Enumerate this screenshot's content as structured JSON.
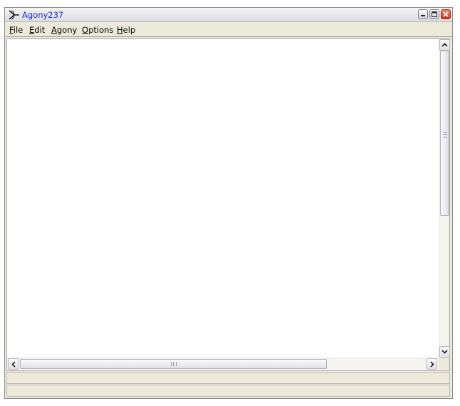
{
  "window": {
    "title": "Agony237",
    "app_icon": "agony-icon",
    "title_color": "#1a2bd4",
    "controls": [
      "minimize-icon",
      "maximize-icon",
      "close-icon"
    ]
  },
  "menu": {
    "items": [
      {
        "mnemonic": "F",
        "rest": "ile"
      },
      {
        "mnemonic": "E",
        "rest": "dit"
      },
      {
        "mnemonic": "A",
        "rest": "gony"
      },
      {
        "mnemonic": "O",
        "rest": "ptions"
      },
      {
        "mnemonic": "H",
        "rest": "elp"
      }
    ]
  },
  "content": {
    "text": ""
  },
  "status": {
    "line1": "",
    "line2": ""
  }
}
